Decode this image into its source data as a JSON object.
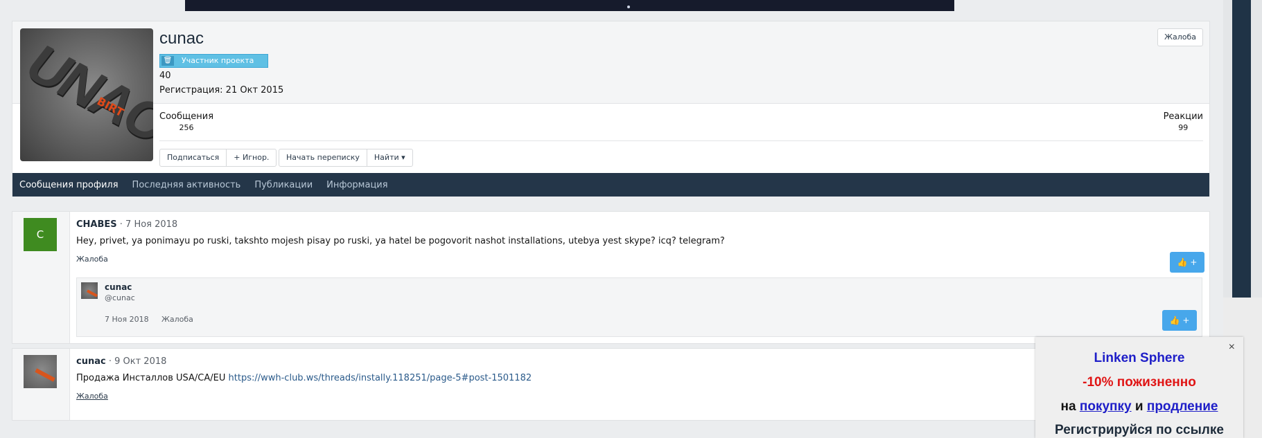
{
  "profile": {
    "username": "cunac",
    "role_badge": "Участник проекта",
    "message_count_short": "40",
    "registration": "Регистрация: 21 Окт 2015",
    "report_label": "Жалоба",
    "stats": [
      {
        "label": "Сообщения",
        "value": "256"
      },
      {
        "label": "Реакции",
        "value": "99"
      }
    ],
    "actions_group1": [
      "Подписаться",
      "+ Игнор."
    ],
    "actions_group2": [
      "Начать переписку",
      "Найти ▾"
    ],
    "tabs": [
      {
        "label": "Сообщения профиля",
        "active": true
      },
      {
        "label": "Последняя активность",
        "active": false
      },
      {
        "label": "Публикации",
        "active": false
      },
      {
        "label": "Информация",
        "active": false
      }
    ]
  },
  "posts": [
    {
      "avatar_letter": "C",
      "author": "CHABES",
      "date": " · 7 Ноя 2018",
      "text": "Hey, privet, ya ponimayu po ruski, takshto mojesh pisay po ruski, ya hatel be pogovorit nashot installations, utebya yest skype? icq? telegram?",
      "report": "Жалоба",
      "like_label": "👍 +",
      "comment": {
        "author": "cunac",
        "handle": "@cunac",
        "date": "7 Ноя 2018",
        "report": "Жалоба",
        "like_label": "👍 +"
      }
    },
    {
      "author": "cunac",
      "date": " · 9 Окт 2018",
      "text_prefix": "Продажа Инсталлов USA/CA/EU ",
      "link": "https://wwh-club.ws/threads/instally.118251/page-5#post-1501182",
      "report": "Жалоба",
      "like_label": "👍 +"
    }
  ],
  "promo": {
    "close": "×",
    "line1": "Linken Sphere",
    "line2": "-10% пожизненно",
    "line3_pre": "на ",
    "line3_link1": "покупку",
    "line3_mid": " и ",
    "line3_link2": "продление",
    "line4": "Регистрируйся по ссылке"
  },
  "colors": {
    "tab_bar": "#243649",
    "badge": "#5fc0e4",
    "like_button": "#47a7eb",
    "avatar_c": "#3f8b20",
    "promo_blue": "#1e1ec8",
    "promo_red": "#e01515"
  }
}
